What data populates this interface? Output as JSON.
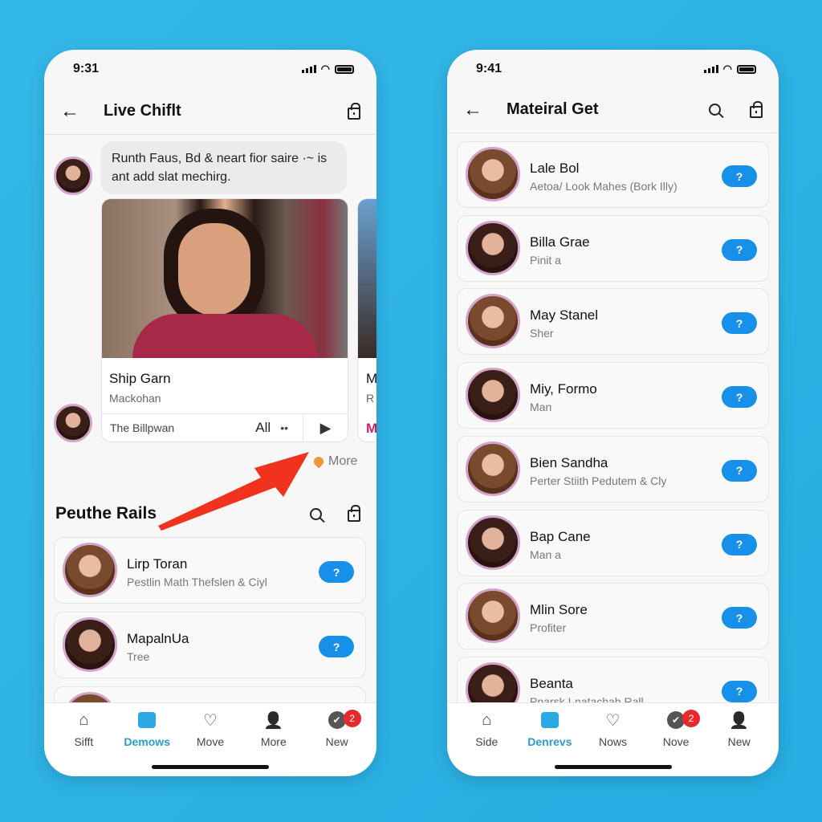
{
  "colors": {
    "background": "#2fb4e6",
    "accent": "#1690e8",
    "badge": "#e8282c",
    "annotation_arrow": "#f0321e"
  },
  "left": {
    "time": "9:31",
    "title": "Live Chiflt",
    "chat_message": "Runth Faus, Bd & neart fior saire ·~ is ant add slat mechirg.",
    "card": {
      "title": "Ship Garn",
      "subtitle": "Mackohan",
      "footer_text": "The Billpwan",
      "footer_label": "All",
      "footer_dots": "••"
    },
    "card2": {
      "title": "M",
      "subtitle": "R",
      "footer": "M"
    },
    "more_label": "More",
    "section_title": "Peuthe Rails",
    "rows": [
      {
        "name": "Lirp Toran",
        "sub": "Pestlin Math Thefslen & Ciyl",
        "button": "?"
      },
      {
        "name": "MapalnUa",
        "sub": "Tree",
        "button": "?"
      },
      {
        "name": "",
        "sub": "",
        "button": ""
      }
    ],
    "tabs": [
      {
        "label": "Sifft",
        "icon": "home-icon"
      },
      {
        "label": "Demows",
        "icon": "box-icon"
      },
      {
        "label": "Move",
        "icon": "heart-icon"
      },
      {
        "label": "More",
        "icon": "person-icon"
      },
      {
        "label": "New",
        "icon": "check-icon",
        "badge": "2"
      }
    ],
    "active_tab": 1
  },
  "right": {
    "time": "9:41",
    "title": "Mateiral Get",
    "rows": [
      {
        "name": "Lale Bol",
        "sub": "Aetoa/ Look Mahes (Bork Illy)",
        "button": "?"
      },
      {
        "name": "Billa Grae",
        "sub": "Pinit a",
        "button": "?"
      },
      {
        "name": "May Stanel",
        "sub": "Sher",
        "button": "?"
      },
      {
        "name": "Miy, Formo",
        "sub": "Man",
        "button": "?"
      },
      {
        "name": "Bien Sandha",
        "sub": "Perter Stiith Pedutem & Cly",
        "button": "?"
      },
      {
        "name": "Bap Cane",
        "sub": "Man a",
        "button": "?"
      },
      {
        "name": "Mlin Sore",
        "sub": "Profiter",
        "button": "?"
      },
      {
        "name": "Beanta",
        "sub": "Pparsk I-natachah Rall",
        "button": "?"
      }
    ],
    "tabs": [
      {
        "label": "Side",
        "icon": "home-icon"
      },
      {
        "label": "Denrevs",
        "icon": "box-icon"
      },
      {
        "label": "Nows",
        "icon": "heart-icon"
      },
      {
        "label": "Nove",
        "icon": "check-icon",
        "badge": "2"
      },
      {
        "label": "New",
        "icon": "person-icon"
      }
    ],
    "active_tab": 1
  }
}
